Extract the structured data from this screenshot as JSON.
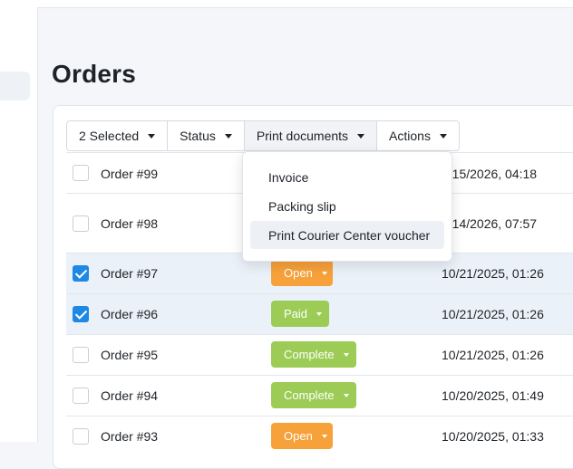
{
  "page": {
    "title": "Orders"
  },
  "toolbar": {
    "selected_label": "2 Selected",
    "status_label": "Status",
    "print_label": "Print documents",
    "actions_label": "Actions"
  },
  "print_menu": {
    "items": [
      {
        "label": "Invoice"
      },
      {
        "label": "Packing slip"
      },
      {
        "label": "Print Courier Center voucher"
      }
    ]
  },
  "orders": [
    {
      "order": "Order #99",
      "status": "",
      "date": "7/15/2026, 04:18",
      "selected": false
    },
    {
      "order": "Order #98",
      "status": "",
      "date": "7/14/2026, 07:57",
      "selected": false
    },
    {
      "order": "Order #97",
      "status": "Open",
      "date": "10/21/2025, 01:26",
      "selected": true
    },
    {
      "order": "Order #96",
      "status": "Paid",
      "date": "10/21/2025, 01:26",
      "selected": true
    },
    {
      "order": "Order #95",
      "status": "Complete",
      "date": "10/21/2025, 01:26",
      "selected": false
    },
    {
      "order": "Order #94",
      "status": "Complete",
      "date": "10/20/2025, 01:49",
      "selected": false
    },
    {
      "order": "Order #93",
      "status": "Open",
      "date": "10/20/2025, 01:33",
      "selected": false
    }
  ],
  "colors": {
    "accent": "#1e88e5",
    "status_open": "#f7a13a",
    "status_paid": "#9ccc55",
    "status_complete": "#9ccc55"
  }
}
